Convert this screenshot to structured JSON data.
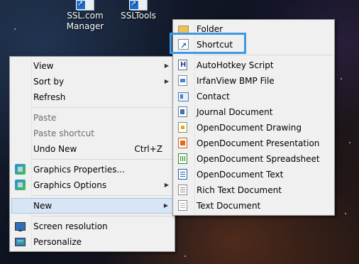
{
  "desktop": {
    "icons": [
      {
        "label_line1": "SSL.com",
        "label_line2": "Manager",
        "icon": "shortcut-icon"
      },
      {
        "label_line1": "SSLTools",
        "label_line2": "",
        "icon": "shortcut-icon"
      }
    ]
  },
  "context_menu": {
    "items": [
      {
        "label": "View",
        "submenu": true
      },
      {
        "label": "Sort by",
        "submenu": true
      },
      {
        "label": "Refresh"
      },
      {
        "label": "Paste",
        "disabled": true
      },
      {
        "label": "Paste shortcut",
        "disabled": true
      },
      {
        "label": "Undo New",
        "shortcut": "Ctrl+Z"
      },
      {
        "label": "Graphics Properties...",
        "icon": "graphics-icon"
      },
      {
        "label": "Graphics Options",
        "icon": "graphics-icon",
        "submenu": true
      },
      {
        "label": "New",
        "submenu": true,
        "highlighted": true
      },
      {
        "label": "Screen resolution",
        "icon": "screen-icon"
      },
      {
        "label": "Personalize",
        "icon": "personalize-icon"
      }
    ]
  },
  "new_submenu": {
    "items": [
      {
        "label": "Folder",
        "icon": "folder-icon"
      },
      {
        "label": "Shortcut",
        "icon": "shortcut-icon",
        "focused": true
      },
      {
        "label": "AutoHotkey Script",
        "icon": "autohotkey-icon"
      },
      {
        "label": "IrfanView BMP File",
        "icon": "bmp-file-icon"
      },
      {
        "label": "Contact",
        "icon": "contact-icon"
      },
      {
        "label": "Journal Document",
        "icon": "journal-icon"
      },
      {
        "label": "OpenDocument Drawing",
        "icon": "odf-drawing-icon"
      },
      {
        "label": "OpenDocument Presentation",
        "icon": "odf-presentation-icon"
      },
      {
        "label": "OpenDocument Spreadsheet",
        "icon": "odf-spreadsheet-icon"
      },
      {
        "label": "OpenDocument Text",
        "icon": "odf-text-icon"
      },
      {
        "label": "Rich Text Document",
        "icon": "rtf-icon"
      },
      {
        "label": "Text Document",
        "icon": "text-document-icon"
      }
    ]
  },
  "colors": {
    "menu_bg": "#f0f0f0",
    "highlight_bg": "#d8e5f5",
    "focus_outline": "#3b9ae8"
  }
}
